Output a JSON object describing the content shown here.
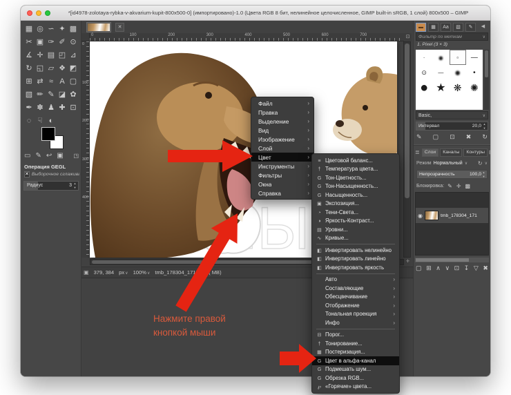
{
  "window": {
    "title": "*[id4978-zolotaya-rybka-v-akvarium-kupit-800x500-0] (импортировано)-1.0 (Цвета RGB 8 бит, нелинейное целочисленное, GIMP built-in sRGB, 1 слой) 800x500 – GIMP"
  },
  "glyphs": {
    "close": "✕",
    "chevron_down": "∨",
    "submenu_arrow": "›",
    "spin_up": "▴",
    "spin_down": "▾",
    "refresh": "↻",
    "eye": "◉",
    "check": "✕",
    "dock_menu": "◀",
    "layers_menu": "≣",
    "dock_add": "⊞",
    "quickmask": "▣",
    "nav": "✛",
    "ruler_unit": "0",
    "corner_nav": "⊡"
  },
  "toolbox": {
    "tools": [
      {
        "name": "rect-select",
        "glyph": "▦"
      },
      {
        "name": "ellipse-select",
        "glyph": "◎"
      },
      {
        "name": "free-select",
        "glyph": "∽"
      },
      {
        "name": "fuzzy-select",
        "glyph": "✦"
      },
      {
        "name": "select-by-color",
        "glyph": "▩"
      },
      {
        "name": "scissors-select",
        "glyph": "✂"
      },
      {
        "name": "foreground-select",
        "glyph": "▣"
      },
      {
        "name": "paths",
        "glyph": "✑"
      },
      {
        "name": "color-picker",
        "glyph": "✐"
      },
      {
        "name": "zoom",
        "glyph": "⊙"
      },
      {
        "name": "measure",
        "glyph": "∡"
      },
      {
        "name": "move",
        "glyph": "✛"
      },
      {
        "name": "align",
        "glyph": "▤"
      },
      {
        "name": "crop",
        "glyph": "◰"
      },
      {
        "name": "unified-transform",
        "glyph": "⊿"
      },
      {
        "name": "rotate",
        "glyph": "↻"
      },
      {
        "name": "scale",
        "glyph": "◱"
      },
      {
        "name": "shear",
        "glyph": "▱"
      },
      {
        "name": "handle-transform",
        "glyph": "❖"
      },
      {
        "name": "perspective",
        "glyph": "◩"
      },
      {
        "name": "3d-transform",
        "glyph": "⊞"
      },
      {
        "name": "flip",
        "glyph": "⇄"
      },
      {
        "name": "warp",
        "glyph": "≈"
      },
      {
        "name": "text",
        "glyph": "A"
      },
      {
        "name": "cage-transform",
        "glyph": "▢"
      },
      {
        "name": "gradient",
        "glyph": "▧"
      },
      {
        "name": "pencil",
        "glyph": "✏"
      },
      {
        "name": "paintbrush",
        "glyph": "✎"
      },
      {
        "name": "eraser",
        "glyph": "◪"
      },
      {
        "name": "airbrush",
        "glyph": "✿"
      },
      {
        "name": "ink",
        "glyph": "✒"
      },
      {
        "name": "mypaint-brush",
        "glyph": "✽"
      },
      {
        "name": "clone",
        "glyph": "♟"
      },
      {
        "name": "heal",
        "glyph": "✚"
      },
      {
        "name": "perspective-clone",
        "glyph": "⊡"
      },
      {
        "name": "blur-sharpen",
        "glyph": "◌"
      },
      {
        "name": "smudge",
        "glyph": "☟"
      },
      {
        "name": "dodge-burn",
        "glyph": "◐"
      }
    ],
    "indicator_icons": [
      {
        "name": "brushes-indicator",
        "glyph": "▭"
      },
      {
        "name": "patterns-indicator",
        "glyph": "✎"
      },
      {
        "name": "undo-history",
        "glyph": "↩"
      },
      {
        "name": "active-image",
        "glyph": "▣"
      },
      {
        "name": "toolbox-menu",
        "glyph": "◳"
      }
    ],
    "tool_options": {
      "title": "Операция GEGL",
      "operation_name": "Выборочное сглаживание",
      "radius_label": "Радиус",
      "radius_value": "3"
    }
  },
  "canvas": {
    "h_ruler": [
      "0",
      "100",
      "200",
      "300",
      "400",
      "500",
      "600",
      "700"
    ],
    "v_ruler": [
      "0",
      "100",
      "200",
      "300",
      "400"
    ],
    "watermark": "ЯБЛЫК",
    "statusbar": {
      "position": "379, 384",
      "unit": "px",
      "zoom": "100%",
      "title": "tmb_178304_1713.jpg ( MB)"
    }
  },
  "context_menu": {
    "items": [
      {
        "label": "Файл"
      },
      {
        "label": "Правка"
      },
      {
        "label": "Выделение"
      },
      {
        "label": "Вид"
      },
      {
        "label": "Изображение"
      },
      {
        "label": "Слой"
      },
      {
        "label": "Цвет",
        "highlighted": true
      },
      {
        "label": "Инструменты"
      },
      {
        "label": "Фильтры"
      },
      {
        "label": "Окна"
      },
      {
        "label": "Справка"
      }
    ]
  },
  "color_submenu": {
    "sections": [
      {
        "items": [
          {
            "icon": "≡",
            "label": "Цветовой баланс..."
          },
          {
            "icon": "†",
            "label": "Температура цвета..."
          },
          {
            "icon": "G",
            "label": "Тон-Цветность..."
          },
          {
            "icon": "G",
            "label": "Тон-Насыщенность..."
          },
          {
            "icon": "G",
            "label": "Насыщенность..."
          },
          {
            "icon": "▣",
            "label": "Экспозиция..."
          },
          {
            "icon": "◔",
            "label": "Тени-Света..."
          },
          {
            "icon": "◑",
            "label": "Яркость-Контраст..."
          },
          {
            "icon": "▤",
            "label": "Уровни..."
          },
          {
            "icon": "∿",
            "label": "Кривые..."
          }
        ]
      },
      {
        "items": [
          {
            "icon": "◧",
            "label": "Инвертировать нелинейно"
          },
          {
            "icon": "◧",
            "label": "Инвертировать линейно"
          },
          {
            "icon": "◧",
            "label": "Инвертировать яркость"
          }
        ]
      },
      {
        "items": [
          {
            "icon": "",
            "label": "Авто",
            "arrow": true
          },
          {
            "icon": "",
            "label": "Составляющие",
            "arrow": true
          },
          {
            "icon": "",
            "label": "Обесцвечивание",
            "arrow": true
          },
          {
            "icon": "",
            "label": "Отображение",
            "arrow": true
          },
          {
            "icon": "",
            "label": "Тональная проекция",
            "arrow": true
          },
          {
            "icon": "",
            "label": "Инфо",
            "arrow": true
          }
        ]
      },
      {
        "items": [
          {
            "icon": "⊟",
            "label": "Порог..."
          },
          {
            "icon": "†",
            "label": "Тонирование..."
          },
          {
            "icon": "▦",
            "label": "Постеризация..."
          },
          {
            "icon": "G",
            "label": "Цвет в альфа-канал",
            "highlighted": true
          },
          {
            "icon": "G",
            "label": "Подмешать шум..."
          },
          {
            "icon": "G",
            "label": "Обрезка RGB..."
          },
          {
            "icon": "℘",
            "label": "«Горячие» цвета..."
          }
        ]
      }
    ]
  },
  "right_panel": {
    "dock_tabs": [
      {
        "name": "brushes-tab",
        "glyph": "▬",
        "selected": true
      },
      {
        "name": "patterns-tab",
        "glyph": "▦"
      },
      {
        "name": "fonts-tab",
        "glyph": "Aa"
      },
      {
        "name": "gradients-tab",
        "glyph": "▧"
      },
      {
        "name": "tool-presets-tab",
        "glyph": "✎"
      },
      {
        "name": "dock-menu",
        "glyph": "◀"
      }
    ],
    "filter_placeholder": "Фильтр по меткам",
    "brush_name": "1. Pixel (3 × 3)",
    "brush_tiles": [
      {
        "glyph": "·",
        "size": 8
      },
      {
        "glyph": "●",
        "size": 13,
        "fuzzy": true
      },
      {
        "glyph": "▫",
        "size": 8,
        "selected": true
      },
      {
        "glyph": "―",
        "size": 10
      },
      {
        "glyph": "⊙",
        "size": 9
      },
      {
        "glyph": "—",
        "size": 8
      },
      {
        "glyph": "●",
        "size": 15,
        "fuzzy": true
      },
      {
        "glyph": "•",
        "size": 10
      },
      {
        "glyph": "●",
        "size": 20
      },
      {
        "glyph": "★",
        "size": 16
      },
      {
        "glyph": "❋",
        "size": 14
      },
      {
        "glyph": "✺",
        "size": 14
      }
    ],
    "category": "Basic,",
    "spacing_label": "Интервал",
    "spacing_value": "20,0",
    "brush_buttons": [
      {
        "name": "edit-brush",
        "glyph": "✎"
      },
      {
        "name": "new-brush",
        "glyph": "▢"
      },
      {
        "name": "duplicate-brush",
        "glyph": "⊡"
      },
      {
        "name": "delete-brush",
        "glyph": "✖"
      },
      {
        "name": "refresh-brushes",
        "glyph": "↻"
      }
    ],
    "layers": {
      "tabs": [
        {
          "label": "Слои",
          "selected": true
        },
        {
          "label": "Каналы"
        },
        {
          "label": "Контуры"
        }
      ],
      "mode_label": "Режим",
      "mode_value": "Нормальный",
      "opacity_label": "Непрозрачность",
      "opacity_value": "100,0",
      "lock_label": "Блокировка:",
      "lock_icons": [
        {
          "name": "lock-pixels",
          "glyph": "✎"
        },
        {
          "name": "lock-position",
          "glyph": "✛"
        },
        {
          "name": "lock-alpha",
          "glyph": "▩"
        }
      ],
      "layer_name": "tmb_178304_171",
      "layer_buttons": [
        {
          "name": "new-layer",
          "glyph": "▢"
        },
        {
          "name": "new-group",
          "glyph": "⊞"
        },
        {
          "name": "raise-layer",
          "glyph": "∧"
        },
        {
          "name": "lower-layer",
          "glyph": "∨"
        },
        {
          "name": "duplicate-layer",
          "glyph": "⊡"
        },
        {
          "name": "anchor-layer",
          "glyph": "↧"
        },
        {
          "name": "merge-down",
          "glyph": "▽"
        },
        {
          "name": "delete-layer",
          "glyph": "✖"
        }
      ]
    }
  },
  "hint": {
    "line1": "Нажмите правой",
    "line2": "кнопкой мыши"
  },
  "colors": {
    "arrow": "#e52412",
    "hint": "#d95a3c"
  }
}
